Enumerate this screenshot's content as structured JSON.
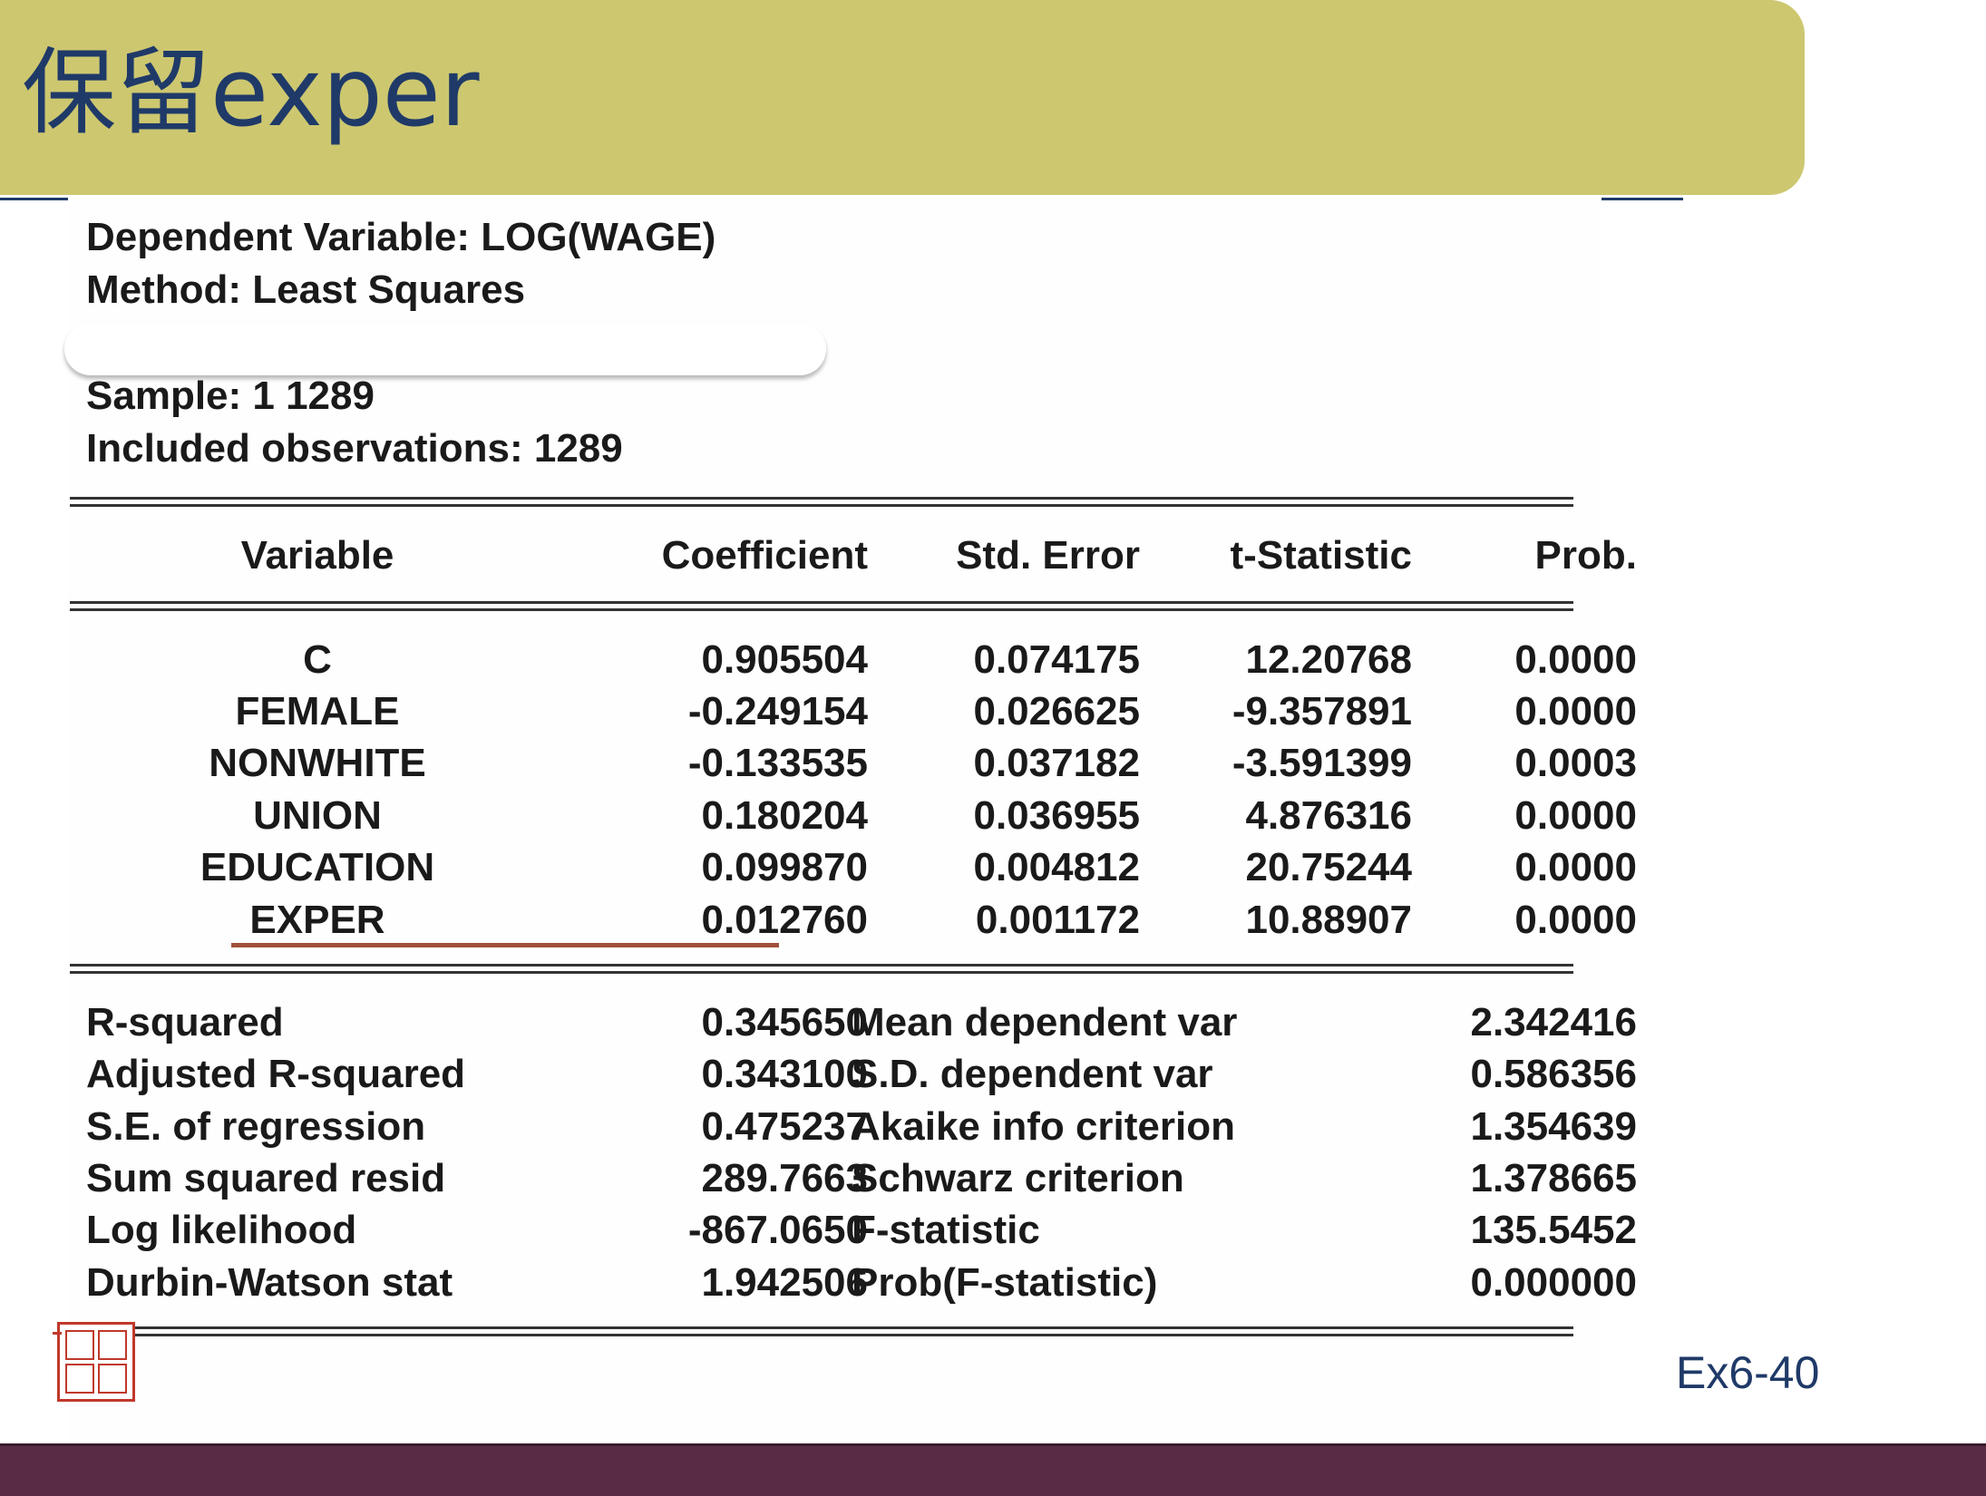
{
  "slide": {
    "title": "保留exper",
    "page_number": "Ex6-40",
    "colors": {
      "title_bar": "#cdc770",
      "title_text": "#1f3a68",
      "footer_bar": "#5a2b45",
      "highlight": "#a0523a",
      "seal": "#c0392b"
    }
  },
  "seal": {
    "icon": "red-seal-stamp-icon"
  },
  "output": {
    "dependent_variable": "Dependent Variable: LOG(WAGE)",
    "method": "Method: Least Squares",
    "sample": "Sample: 1 1289",
    "included_observations": "Included observations: 1289",
    "columns": [
      "Variable",
      "Coefficient",
      "Std. Error",
      "t-Statistic",
      "Prob."
    ],
    "rows": [
      {
        "variable": "C",
        "coefficient": "0.905504",
        "std_error": "0.074175",
        "t_statistic": "12.20768",
        "prob": "0.0000"
      },
      {
        "variable": "FEMALE",
        "coefficient": "-0.249154",
        "std_error": "0.026625",
        "t_statistic": "-9.357891",
        "prob": "0.0000"
      },
      {
        "variable": "NONWHITE",
        "coefficient": "-0.133535",
        "std_error": "0.037182",
        "t_statistic": "-3.591399",
        "prob": "0.0003"
      },
      {
        "variable": "UNION",
        "coefficient": "0.180204",
        "std_error": "0.036955",
        "t_statistic": "4.876316",
        "prob": "0.0000"
      },
      {
        "variable": "EDUCATION",
        "coefficient": "0.099870",
        "std_error": "0.004812",
        "t_statistic": "20.75244",
        "prob": "0.0000"
      },
      {
        "variable": "EXPER",
        "coefficient": "0.012760",
        "std_error": "0.001172",
        "t_statistic": "10.88907",
        "prob": "0.0000"
      }
    ],
    "stats": [
      {
        "label": "R-squared",
        "value": "0.345650",
        "label2": "Mean dependent var",
        "value2": "2.342416"
      },
      {
        "label": "Adjusted R-squared",
        "value": "0.343100",
        "label2": "S.D. dependent var",
        "value2": "0.586356"
      },
      {
        "label": "S.E. of regression",
        "value": "0.475237",
        "label2": "Akaike info criterion",
        "value2": "1.354639"
      },
      {
        "label": "Sum squared resid",
        "value": "289.7663",
        "label2": "Schwarz criterion",
        "value2": "1.378665"
      },
      {
        "label": "Log likelihood",
        "value": "-867.0650",
        "label2": "F-statistic",
        "value2": "135.5452"
      },
      {
        "label": "Durbin-Watson stat",
        "value": "1.942506",
        "label2": "Prob(F-statistic)",
        "value2": "0.000000"
      }
    ]
  }
}
